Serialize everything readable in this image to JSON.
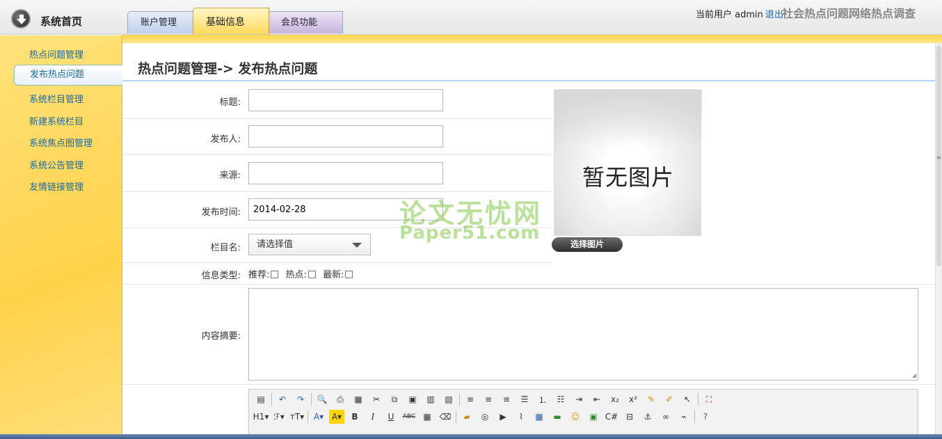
{
  "header": {
    "home_label": "系统首页",
    "tabs": [
      {
        "label": "账户管理"
      },
      {
        "label": "基础信息"
      },
      {
        "label": "会员功能"
      }
    ],
    "user_prefix": "当前用户 admin",
    "logout_label": "退出",
    "site_title": "社会热点问题网络热点调查"
  },
  "sidebar": {
    "items": [
      {
        "label": "热点问题管理"
      },
      {
        "label": "发布热点问题"
      },
      {
        "label": "系统栏目管理"
      },
      {
        "label": "新建系统栏目"
      },
      {
        "label": "系统焦点图管理"
      },
      {
        "label": "系统公告管理"
      },
      {
        "label": "友情链接管理"
      }
    ],
    "active_index": 1
  },
  "main": {
    "page_title": "热点问题管理-> 发布热点问题",
    "form": {
      "title_label": "标题:",
      "title_value": "",
      "publisher_label": "发布人:",
      "publisher_value": "",
      "source_label": "来源:",
      "source_value": "",
      "date_label": "发布时间:",
      "date_value": "2014-02-28",
      "column_label": "栏目名:",
      "column_value": "请选择值",
      "info_type_label": "信息类型:",
      "checks": [
        {
          "label": "推荐:",
          "checked": false
        },
        {
          "label": "热点:",
          "checked": false
        },
        {
          "label": "最新:",
          "checked": false
        }
      ],
      "summary_label": "内容摘要:",
      "summary_value": ""
    },
    "preview": {
      "placeholder_text": "暂无图片",
      "choose_button": "选择图片"
    },
    "watermark": {
      "line1": "论文无忧网",
      "line2": "Paper51.com"
    },
    "editor_toolbar": {
      "row1": [
        "paste-word-icon",
        "undo-icon",
        "redo-icon",
        "preview-icon",
        "print-icon",
        "template-icon",
        "cut-icon",
        "copy-icon",
        "paste-icon",
        "paste-text-icon",
        "paste-word-alt-icon",
        "align-left-icon",
        "align-center-icon",
        "align-right-icon",
        "align-justify-icon",
        "ordered-list-icon",
        "unordered-list-icon",
        "indent-icon",
        "outdent-icon",
        "subscript-icon",
        "superscript-icon",
        "clear-format-icon",
        "format-select-icon",
        "select-all-icon",
        "fullscreen-icon"
      ],
      "row2": [
        "heading-icon",
        "font-family-icon",
        "font-size-icon",
        "font-color-icon",
        "highlight-icon",
        "bold-icon",
        "italic-icon",
        "underline-icon",
        "strikethrough-icon",
        "horizontal-rule-icon",
        "eraser-icon",
        "image-icon",
        "flash-icon",
        "media-icon",
        "attach-icon",
        "table-icon",
        "insert-row-icon",
        "emoji-icon",
        "picture-icon",
        "code-icon",
        "page-break-icon",
        "anchor-icon",
        "link-icon",
        "unlink-icon",
        "help-icon"
      ],
      "heading_text": "H1",
      "bold_text": "B",
      "italic_text": "I",
      "underline_text": "U",
      "strike_text": "ABC",
      "font_color_text": "A",
      "highlight_text": "A"
    }
  }
}
